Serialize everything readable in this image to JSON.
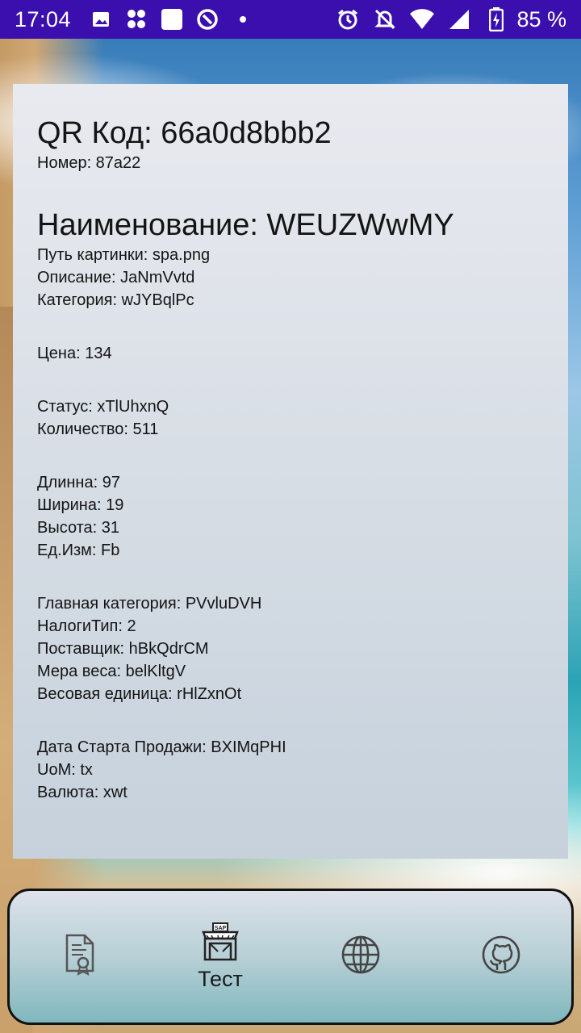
{
  "status_bar": {
    "time": "17:04",
    "battery": "85 %",
    "icons_left": [
      "image-icon",
      "apps-dots-icon",
      "square-icon",
      "sync-icon",
      "dot-icon"
    ],
    "icons_right": [
      "alarm-icon",
      "notifications-off-icon",
      "wifi-icon",
      "signal-icon",
      "battery-charging-icon"
    ]
  },
  "card": {
    "qr_title": "QR Код: 66a0d8bbb2",
    "number": "Номер: 87a22",
    "name_title": "Наименование: WEUZWwMY",
    "image_path": "Путь картинки: spa.png",
    "description": "Описание: JaNmVvtd",
    "category": "Категория: wJYBqlPc",
    "price": "Цена: 134",
    "status": "Статус: xTlUhxnQ",
    "quantity": "Количество: 511",
    "length": "Длинна: 97",
    "width": "Ширина: 19",
    "height": "Высота: 31",
    "unit": "Ед.Изм: Fb",
    "main_category": "Главная категория: PVvluDVH",
    "tax_type": "НалогиТип: 2",
    "supplier": "Поставщик: hBkQdrCM",
    "weight_measure": "Мера веса: belKltgV",
    "weight_unit": "Весовая единица: rHlZxnOt",
    "sale_start_date": "Дата Старта Продажи: BXIMqPHI",
    "uom": "UoM: tx",
    "currency": "Валюта: xwt"
  },
  "bottom_nav": {
    "items": [
      {
        "icon": "certificate-document-icon",
        "label": ""
      },
      {
        "icon": "sap-store-icon",
        "label": "Тест"
      },
      {
        "icon": "globe-icon",
        "label": ""
      },
      {
        "icon": "github-icon",
        "label": ""
      }
    ]
  }
}
